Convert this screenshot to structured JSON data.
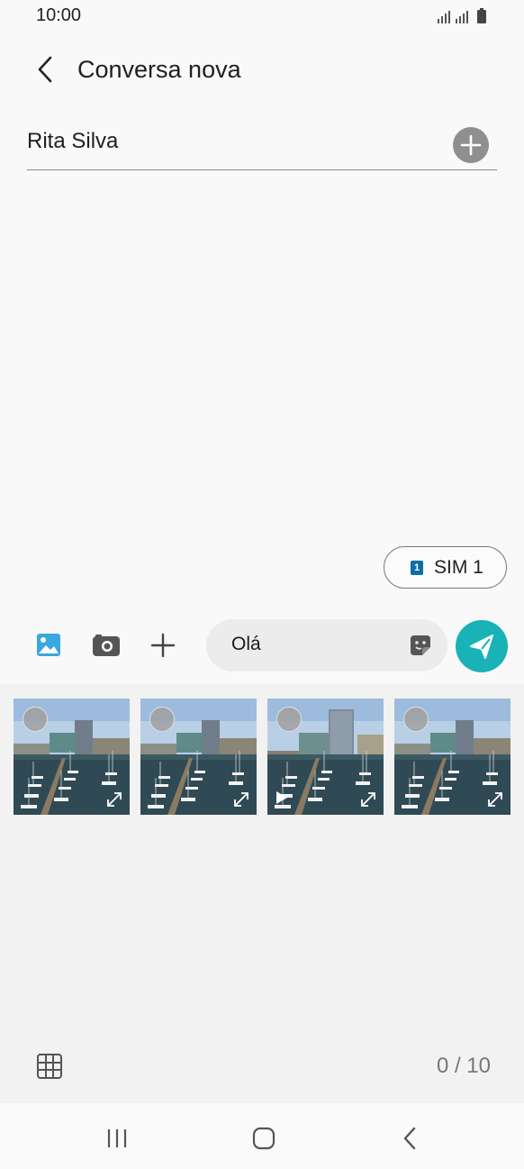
{
  "status_bar": {
    "time": "10:00"
  },
  "header": {
    "title": "Conversa nova",
    "back_icon": "chevron-left-icon"
  },
  "recipient": {
    "name": "Rita Silva",
    "add_icon": "plus-circle-icon"
  },
  "sim": {
    "badge": "1",
    "label": "SIM 1"
  },
  "compose": {
    "message": "Olá",
    "icons": [
      "gallery-icon",
      "camera-icon",
      "plus-icon",
      "sticker-icon",
      "send-icon"
    ],
    "send_color": "#18b2b7"
  },
  "gallery": {
    "thumbnails": [
      {
        "type": "photo"
      },
      {
        "type": "photo"
      },
      {
        "type": "video"
      },
      {
        "type": "photo"
      }
    ],
    "counter": "0 / 10"
  },
  "nav": {
    "icons": [
      "recents-icon",
      "home-icon",
      "back-icon"
    ]
  }
}
